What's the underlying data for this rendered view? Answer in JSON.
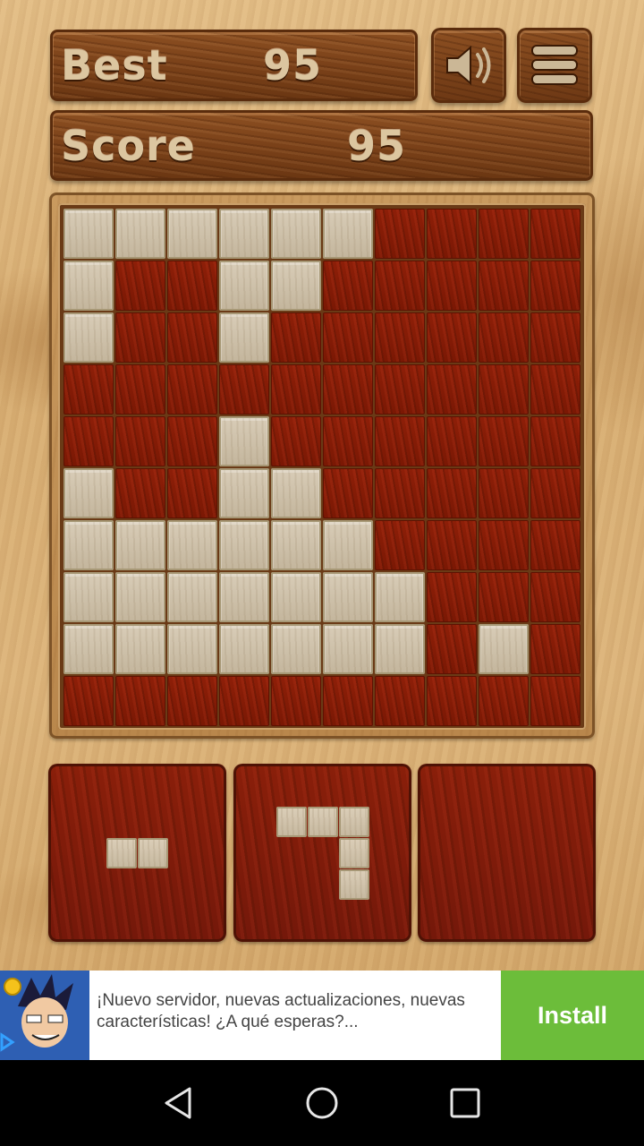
{
  "header": {
    "best_label": "Best",
    "best_value": "95",
    "score_label": "Score",
    "score_value": "95"
  },
  "controls": {
    "sound_icon": "speaker-icon",
    "menu_icon": "hamburger-menu-icon"
  },
  "board": {
    "size": 10,
    "rows": [
      "1111110000",
      "1001100000",
      "1001000000",
      "0000000000",
      "0001000000",
      "1001100000",
      "1111110000",
      "1111111000",
      "1111111010",
      "0000000000"
    ]
  },
  "pieces": [
    {
      "name": "horizontal-domino",
      "cells": [
        [
          0,
          0
        ],
        [
          0,
          1
        ]
      ]
    },
    {
      "name": "hook-piece",
      "cells": [
        [
          0,
          0
        ],
        [
          0,
          1
        ],
        [
          0,
          2
        ],
        [
          1,
          2
        ],
        [
          2,
          2
        ]
      ]
    },
    {
      "name": "empty-slot",
      "cells": []
    }
  ],
  "ad": {
    "text": "¡Nuevo servidor, nuevas actualizaciones, nuevas características! ¿A qué esperas?...",
    "install_label": "Install",
    "install_color": "#6cbd3a"
  },
  "colors": {
    "filled_block": "#c9bca4",
    "empty_cell": "#861d07",
    "plank": "#7a4119"
  },
  "system_nav": {
    "back_icon": "back-triangle-icon",
    "home_icon": "home-circle-icon",
    "recents_icon": "recents-square-icon"
  }
}
